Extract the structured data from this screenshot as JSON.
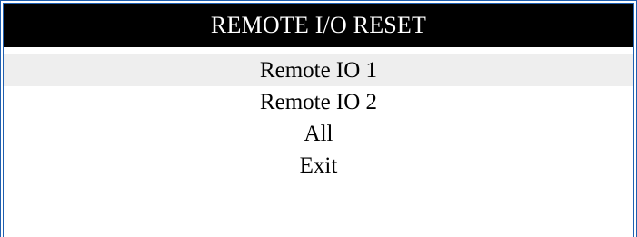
{
  "dialog": {
    "title": "REMOTE I/O RESET",
    "items": [
      {
        "label": "Remote IO 1",
        "selected": true
      },
      {
        "label": "Remote IO 2",
        "selected": false
      },
      {
        "label": "All",
        "selected": false
      },
      {
        "label": "Exit",
        "selected": false
      }
    ]
  },
  "colors": {
    "title_background": "#000000",
    "title_text": "#ffffff",
    "border": "#1f5fb0",
    "selected_background": "#eeeeee"
  }
}
